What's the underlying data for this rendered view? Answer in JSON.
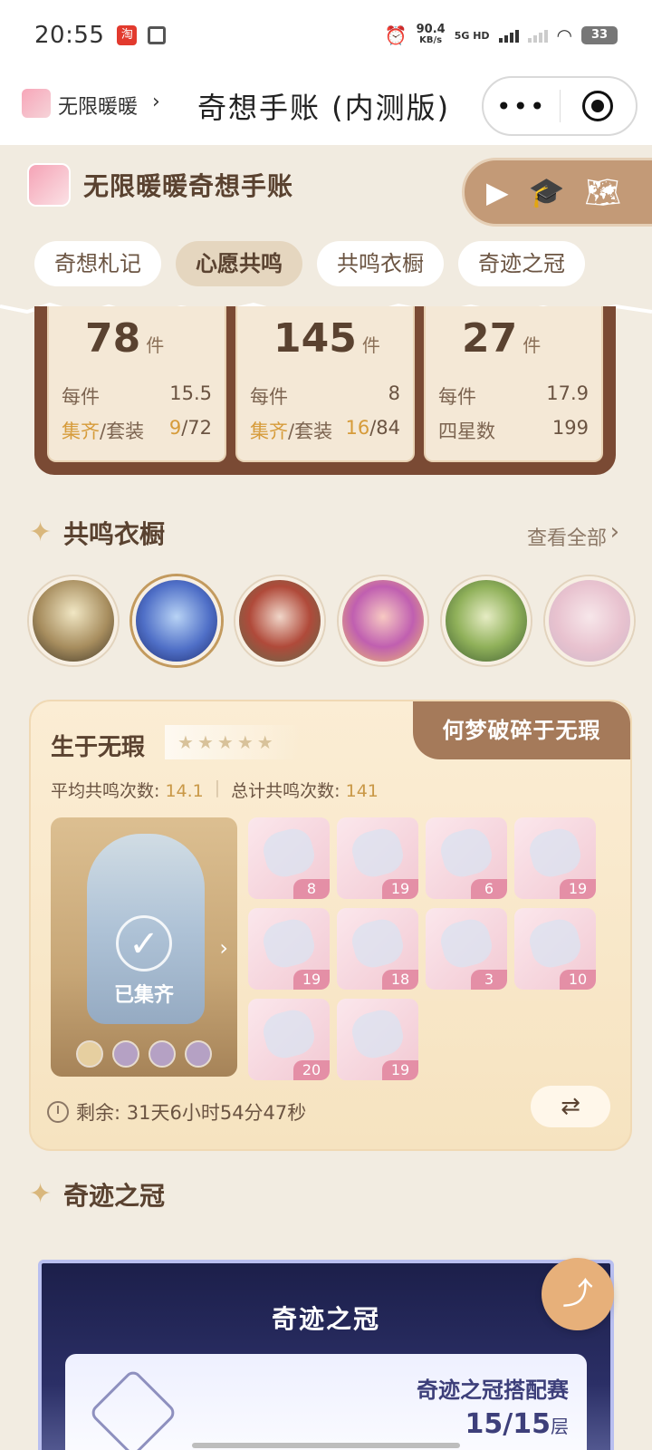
{
  "status_bar": {
    "time": "20:55",
    "speed_value": "90.4",
    "speed_unit": "KB/s",
    "network": "5G HD",
    "battery": "33"
  },
  "nav": {
    "app_name": "无限暖暖",
    "title": "奇想手账 (内测版)",
    "more_label": "•••"
  },
  "header": {
    "brand_title": "无限暖暖奇想手账",
    "tabs": [
      {
        "label": "奇想札记",
        "active": false
      },
      {
        "label": "心愿共鸣",
        "active": true
      },
      {
        "label": "共鸣衣橱",
        "active": false
      },
      {
        "label": "奇迹之冠",
        "active": false
      }
    ]
  },
  "stats": [
    {
      "big": "78",
      "unit": "件",
      "row1_label": "每件",
      "row1_value": "15.5",
      "row2_label_gold": "集齐",
      "row2_label": "/套装",
      "row2_value_gold": "9",
      "row2_value": "/72"
    },
    {
      "big": "145",
      "unit": "件",
      "row1_label": "每件",
      "row1_value": "8",
      "row2_label_gold": "集齐",
      "row2_label": "/套装",
      "row2_value_gold": "16",
      "row2_value": "/84"
    },
    {
      "big": "27",
      "unit": "件",
      "row1_label": "每件",
      "row1_value": "17.9",
      "row2_label_gold": "",
      "row2_label": "四星数",
      "row2_value_gold": "",
      "row2_value": "199"
    }
  ],
  "wardrobe": {
    "section_title": "共鸣衣橱",
    "view_all": "查看全部",
    "avatars": 6
  },
  "outfit": {
    "name": "生于无瑕",
    "banner": "何梦破碎于无瑕",
    "avg_label": "平均共鸣次数:",
    "avg_value": "14.1",
    "total_label": "总计共鸣次数:",
    "total_value": "141",
    "collected_label": "已集齐",
    "items": [
      "8",
      "19",
      "6",
      "19",
      "19",
      "18",
      "3",
      "10",
      "20",
      "19"
    ],
    "timer_label": "剩余: 31天6小时54分47秒",
    "swap_icon": "⇄"
  },
  "crown": {
    "section_title": "奇迹之冠",
    "card_title": "奇迹之冠",
    "event_title": "奇迹之冠搭配赛",
    "progress": "15/15",
    "progress_unit": "层"
  },
  "icons": {
    "play": "▶",
    "share": "⤴"
  }
}
